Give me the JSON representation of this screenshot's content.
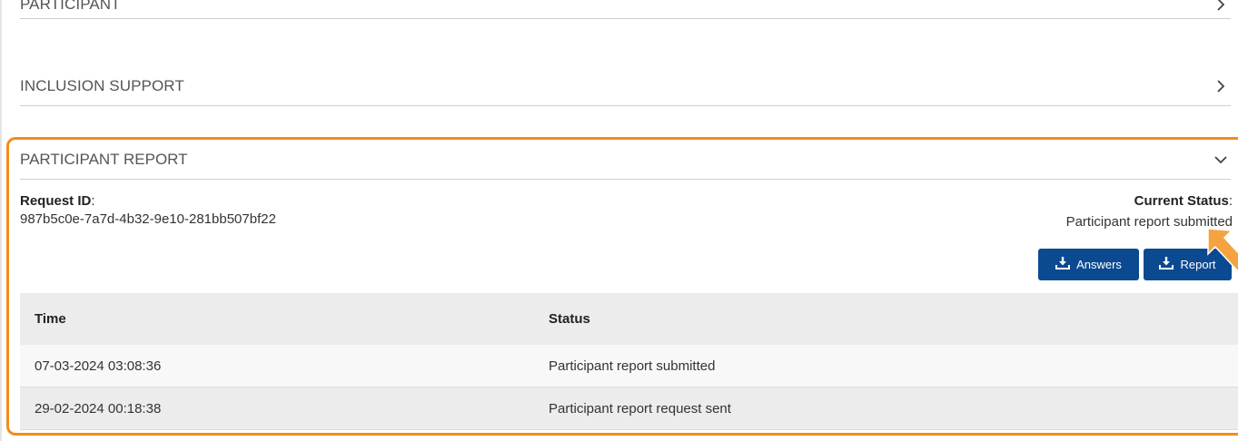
{
  "sections": {
    "participant": {
      "label": "PARTICIPANT",
      "icon": "chevron-right-icon"
    },
    "inclusion_support": {
      "label": "INCLUSION SUPPORT",
      "icon": "chevron-right-icon"
    }
  },
  "report": {
    "title": "PARTICIPANT REPORT",
    "toggle_icon": "chevron-down-icon",
    "request_id_label": "Request ID",
    "request_id": "987b5c0e-7a7d-4b32-9e10-281bb507bf22",
    "current_status_label": "Current Status",
    "current_status": "Participant report submitted",
    "buttons": {
      "answers": "Answers",
      "report": "Report"
    },
    "table": {
      "headers": {
        "time": "Time",
        "status": "Status"
      },
      "rows": [
        {
          "time": "07-03-2024 03:08:36",
          "status": "Participant report submitted"
        },
        {
          "time": "29-02-2024 00:18:38",
          "status": "Participant report request sent"
        }
      ]
    }
  },
  "colors": {
    "highlight_border": "#f28c1e",
    "button_bg": "#0b4a91",
    "header_row_bg": "#ececec"
  }
}
